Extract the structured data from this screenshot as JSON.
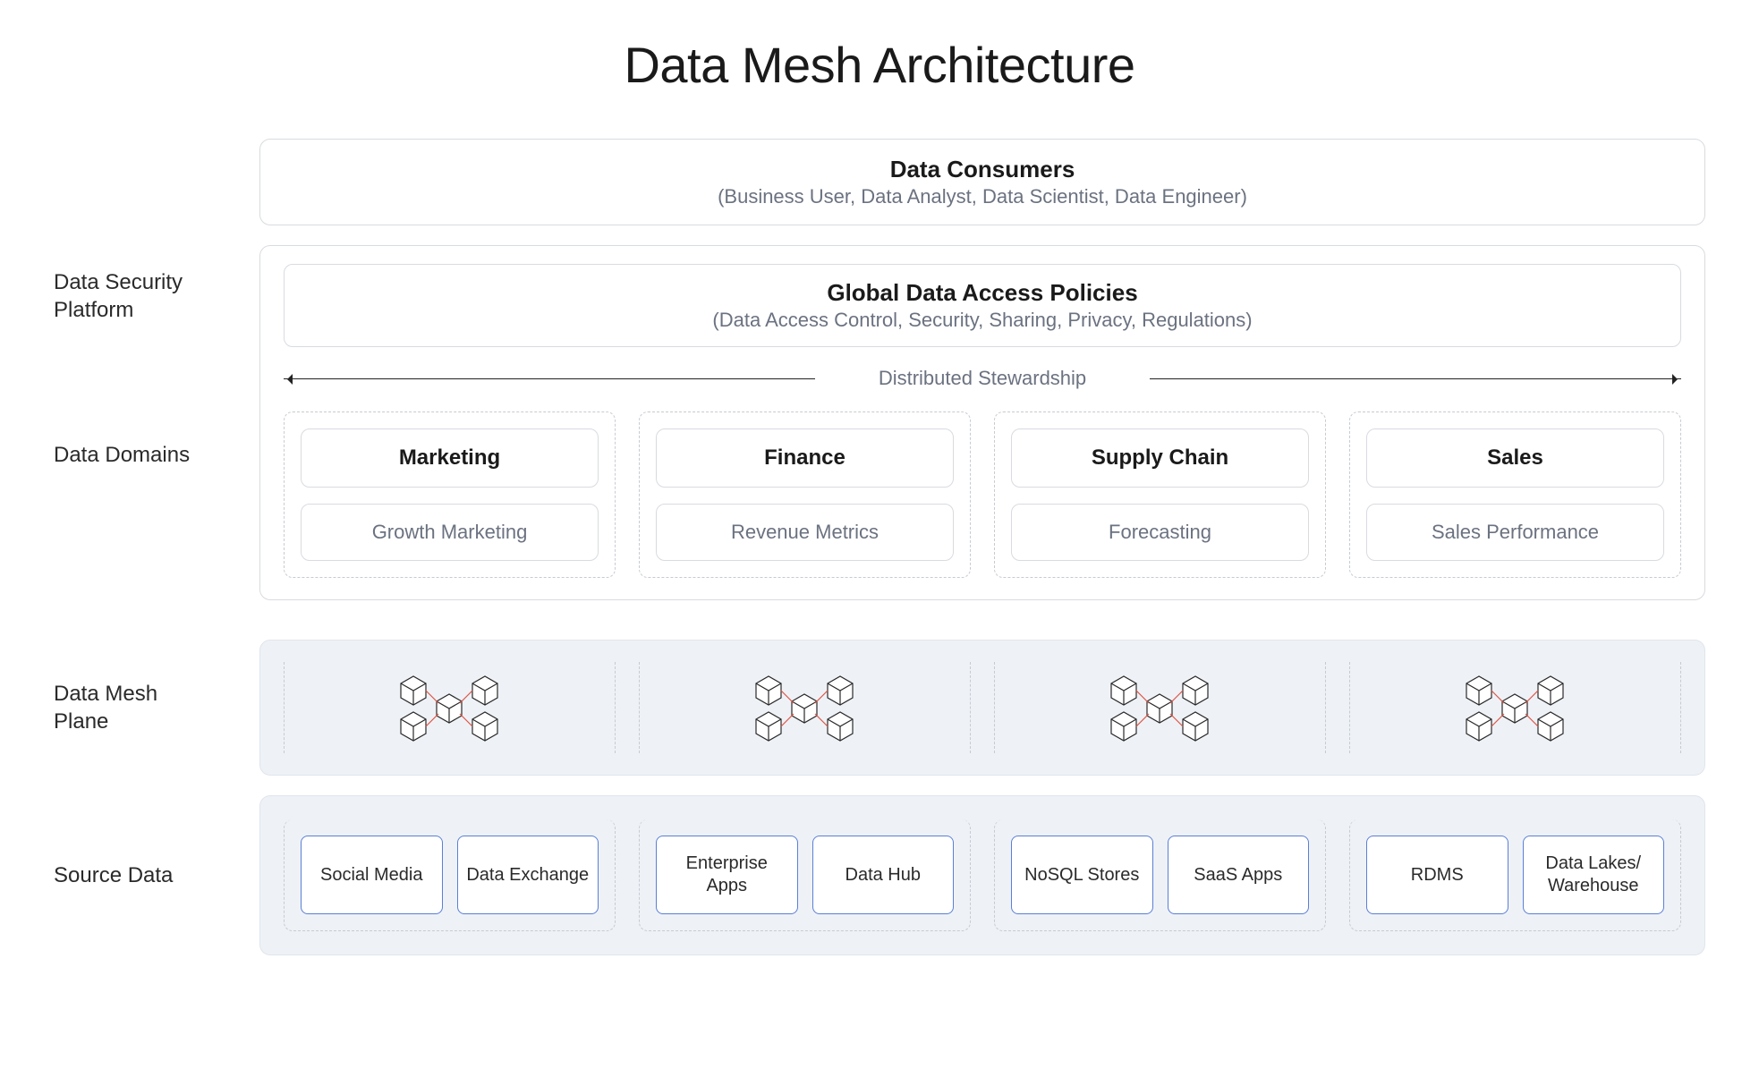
{
  "title": "Data Mesh Architecture",
  "rows": {
    "consumers": {
      "heading": "Data Consumers",
      "sub": "(Business User, Data Analyst, Data Scientist, Data Engineer)"
    },
    "security_label": "Data Security\nPlatform",
    "policies": {
      "heading": "Global Data Access Policies",
      "sub": "(Data Access Control, Security, Sharing, Privacy, Regulations)"
    },
    "stewardship_label": "Distributed Stewardship",
    "domains_label": "Data Domains",
    "domains": [
      {
        "name": "Marketing",
        "product": "Growth Marketing"
      },
      {
        "name": "Finance",
        "product": "Revenue Metrics"
      },
      {
        "name": "Supply Chain",
        "product": "Forecasting"
      },
      {
        "name": "Sales",
        "product": "Sales Performance"
      }
    ],
    "mesh_label": "Data Mesh\nPlane",
    "mesh_icon": "mesh-cubes-icon",
    "source_label": "Source Data",
    "sources": [
      [
        "Social Media",
        "Data Exchange"
      ],
      [
        "Enterprise Apps",
        "Data Hub"
      ],
      [
        "NoSQL Stores",
        "SaaS Apps"
      ],
      [
        "RDMS",
        "Data Lakes/ Warehouse"
      ]
    ]
  }
}
